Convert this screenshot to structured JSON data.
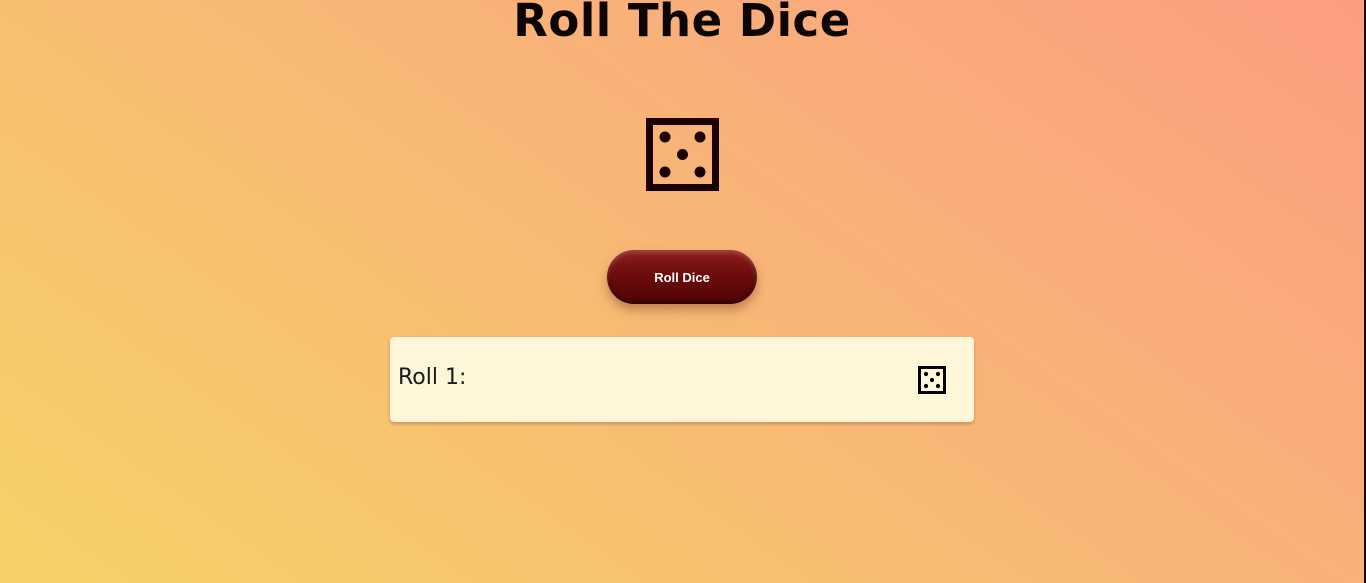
{
  "app": {
    "title": "Roll The Dice"
  },
  "current_die": {
    "face_value": 5,
    "icon": "dice-five-icon"
  },
  "controls": {
    "roll_button_label": "Roll Dice"
  },
  "history": [
    {
      "label": "Roll 1:",
      "face_value": 5,
      "icon": "dice-five-icon"
    }
  ],
  "colors": {
    "button": "#6e0c0c",
    "die_main": "#1a0202",
    "die_small": "#000000",
    "card_background": "#fff5d9",
    "text": "#0d0404"
  }
}
